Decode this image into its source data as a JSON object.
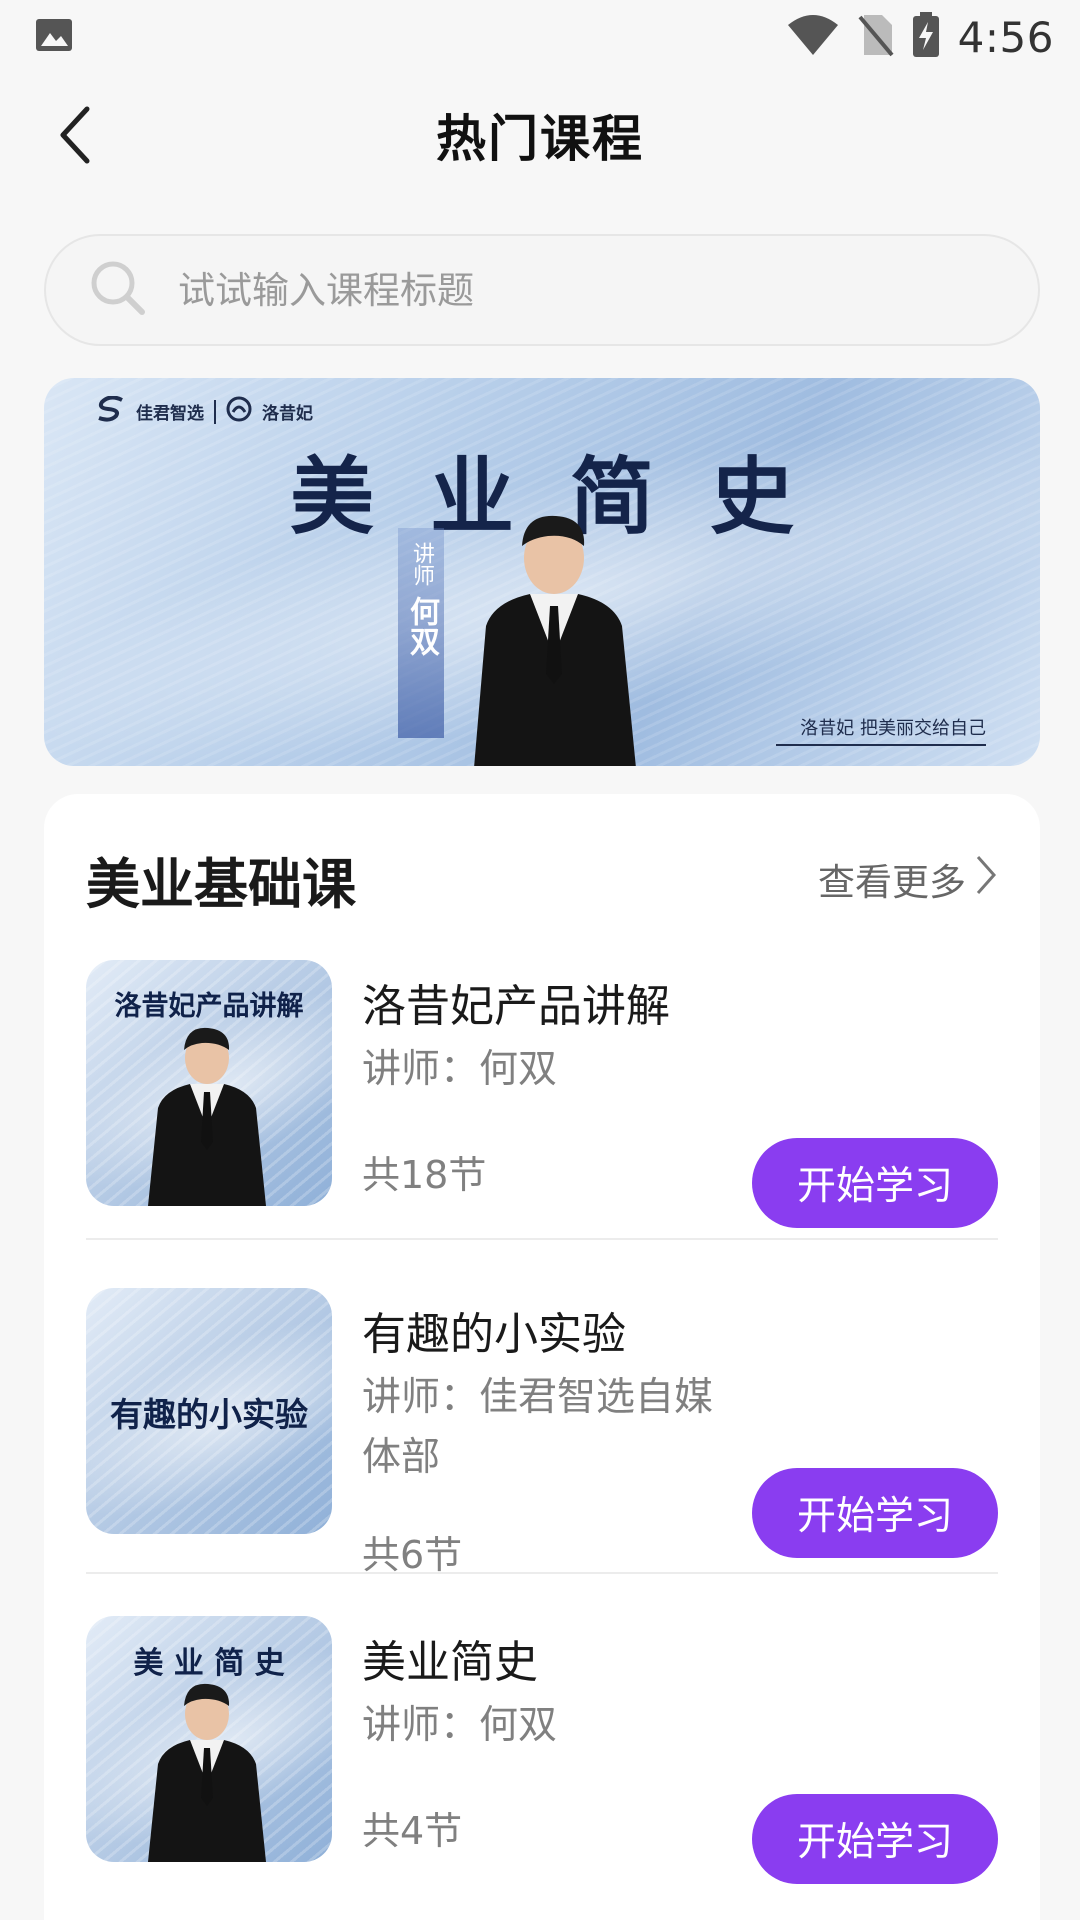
{
  "status_bar": {
    "time": "4:56",
    "icons": [
      "image-icon",
      "wifi-icon",
      "no-sim-icon",
      "battery-charging-icon"
    ]
  },
  "header": {
    "title": "热门课程",
    "back_icon": "chevron-left-icon"
  },
  "search": {
    "placeholder": "试试输入课程标题",
    "icon": "search-icon"
  },
  "banner": {
    "logo_left": "佳君智选",
    "logo_right": "洛昔妃",
    "title": "美业简史",
    "lecturer_label": "讲师",
    "lecturer_name": "何双",
    "slogan": "洛昔妃 把美丽交给自己"
  },
  "section": {
    "title": "美业基础课",
    "more_label": "查看更多",
    "courses": [
      {
        "thumb_title": "洛昔妃产品讲解",
        "name": "洛昔妃产品讲解",
        "teacher": "讲师：何双",
        "count": "共18节",
        "button": "开始学习"
      },
      {
        "thumb_title": "有趣的小实验",
        "name": "有趣的小实验",
        "teacher": "讲师：佳君智选自媒体部",
        "count": "共6节",
        "button": "开始学习"
      },
      {
        "thumb_title": "美 业 简 史",
        "name": "美业简史",
        "teacher": "讲师：何双",
        "count": "共4节",
        "button": "开始学习"
      }
    ]
  },
  "colors": {
    "accent": "#8a3df0",
    "background": "#f7f7f7",
    "card": "#ffffff"
  }
}
